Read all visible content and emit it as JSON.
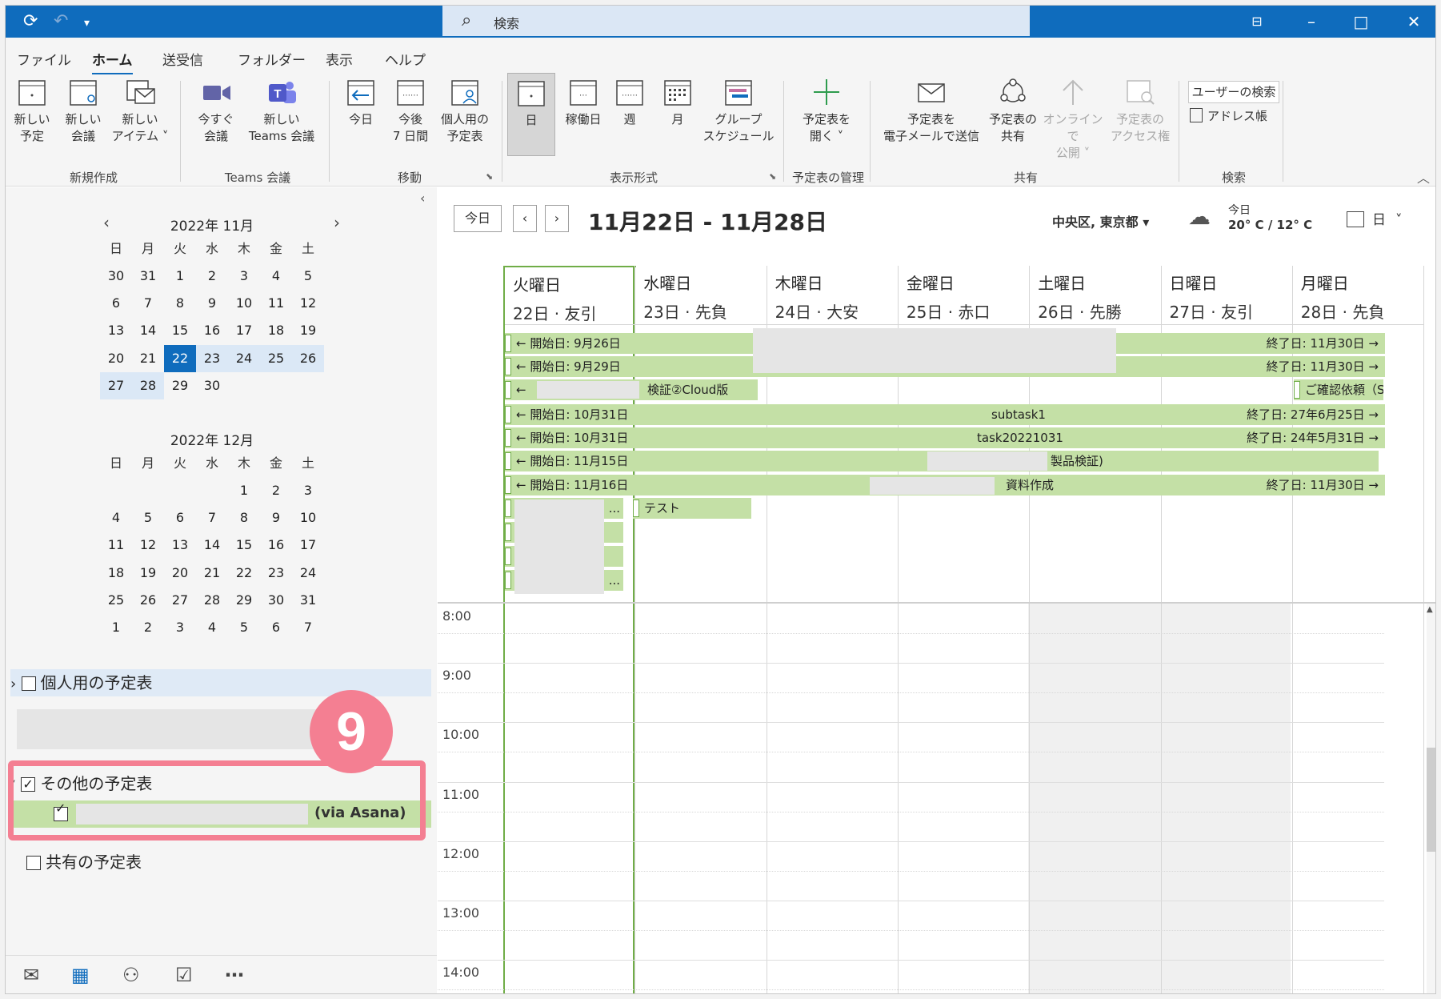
{
  "titlebar": {
    "search_placeholder": "検索"
  },
  "menu": [
    "ファイル",
    "ホーム",
    "送受信",
    "フォルダー",
    "表示",
    "ヘルプ"
  ],
  "ribbon": {
    "new_appointment": [
      "新しい",
      "予定"
    ],
    "new_meeting": [
      "新しい",
      "会議"
    ],
    "new_items": [
      "新しい",
      "アイテム ˅"
    ],
    "group_new": "新規作成",
    "meet_now": [
      "今すぐ",
      "会議"
    ],
    "teams_meeting": [
      "新しい",
      "Teams 会議"
    ],
    "group_teams": "Teams 会議",
    "today": [
      "今日",
      ""
    ],
    "next7": [
      "今後",
      "7 日間"
    ],
    "personal_cal": [
      "個人用の",
      "予定表"
    ],
    "group_move": "移動",
    "view_day": "日",
    "view_workweek": "稼働日",
    "view_week": "週",
    "view_month": "月",
    "view_group": [
      "グループ",
      "スケジュール"
    ],
    "group_view": "表示形式",
    "open_cal": [
      "予定表を",
      "開く ˅"
    ],
    "group_manage": "予定表の管理",
    "email_cal": [
      "予定表を",
      "電子メールで送信"
    ],
    "share_cal": [
      "予定表の",
      "共有"
    ],
    "publish_online": [
      "オンラインで",
      "公開 ˅"
    ],
    "cal_perm": [
      "予定表の",
      "アクセス権"
    ],
    "group_share": "共有",
    "user_search": "ユーザーの検索",
    "address_book": "アドレス帳",
    "group_search": "検索"
  },
  "minical_nov": {
    "title": "2022年 11月",
    "dow": [
      "日",
      "月",
      "火",
      "水",
      "木",
      "金",
      "土"
    ],
    "weeks": [
      [
        "30",
        "31",
        "1",
        "2",
        "3",
        "4",
        "5"
      ],
      [
        "6",
        "7",
        "8",
        "9",
        "10",
        "11",
        "12"
      ],
      [
        "13",
        "14",
        "15",
        "16",
        "17",
        "18",
        "19"
      ],
      [
        "20",
        "21",
        "22",
        "23",
        "24",
        "25",
        "26"
      ],
      [
        "27",
        "28",
        "29",
        "30",
        "",
        "",
        ""
      ]
    ]
  },
  "minical_dec": {
    "title": "2022年 12月",
    "dow": [
      "日",
      "月",
      "火",
      "水",
      "木",
      "金",
      "土"
    ],
    "weeks": [
      [
        "",
        "",
        "",
        "",
        "1",
        "2",
        "3"
      ],
      [
        "4",
        "5",
        "6",
        "7",
        "8",
        "9",
        "10"
      ],
      [
        "11",
        "12",
        "13",
        "14",
        "15",
        "16",
        "17"
      ],
      [
        "18",
        "19",
        "20",
        "21",
        "22",
        "23",
        "24"
      ],
      [
        "25",
        "26",
        "27",
        "28",
        "29",
        "30",
        "31"
      ],
      [
        "1",
        "2",
        "3",
        "4",
        "5",
        "6",
        "7"
      ]
    ]
  },
  "folders": {
    "personal": "個人用の予定表",
    "other": "その他の予定表",
    "asana_suffix": "(via Asana)",
    "shared": "共有の予定表"
  },
  "step_badge": "9",
  "calendar": {
    "today_btn": "今日",
    "range_title": "11月22日 - 11月28日",
    "location": "中央区, 東京都 ▾",
    "weather_label": "今日",
    "weather_temp": "20° C / 12° C",
    "view_label": "日",
    "days": [
      {
        "name": "火曜日",
        "sub": "22日 · 友引"
      },
      {
        "name": "水曜日",
        "sub": "23日 · 先負"
      },
      {
        "name": "木曜日",
        "sub": "24日 · 大安"
      },
      {
        "name": "金曜日",
        "sub": "25日 · 赤口"
      },
      {
        "name": "土曜日",
        "sub": "26日 · 先勝"
      },
      {
        "name": "日曜日",
        "sub": "27日 · 友引"
      },
      {
        "name": "月曜日",
        "sub": "28日 · 先負"
      }
    ],
    "events": {
      "e1_start": "← 開始日: 9月26日",
      "e1_end": "終了日: 11月30日 →",
      "e2_start": "← 開始日: 9月29日",
      "e2_end": "終了日: 11月30日 →",
      "e3_start": "←",
      "e3_text": "検証②Cloud版",
      "e3b_text": "ご確認依頼（S...",
      "e4_start": "← 開始日: 10月31日",
      "e4_text": "subtask1",
      "e4_end": "終了日: 27年6月25日 →",
      "e5_start": "← 開始日: 10月31日",
      "e5_text": "task20221031",
      "e5_end": "終了日: 24年5月31日 →",
      "e6_start": "← 開始日: 11月15日",
      "e6_text": "製品検証)",
      "e7_start": "← 開始日: 11月16日",
      "e7_text": "資料作成",
      "e7_end": "終了日: 11月30日 →",
      "e8_text": "テスト",
      "ellipsis": "..."
    },
    "times": [
      "8:00",
      "9:00",
      "10:00",
      "11:00",
      "12:00",
      "13:00",
      "14:00"
    ]
  }
}
